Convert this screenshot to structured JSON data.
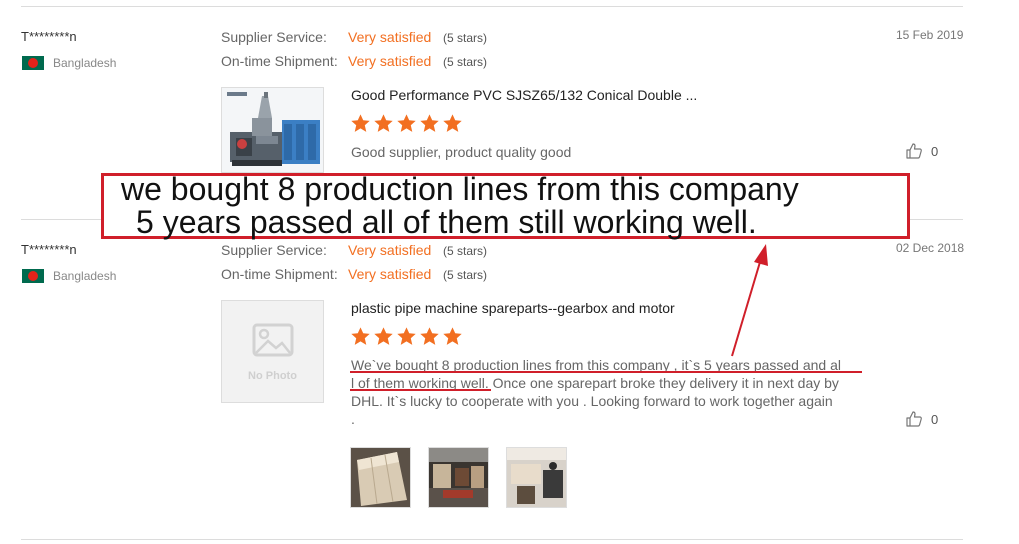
{
  "reviews": [
    {
      "user": "T********n",
      "country": "Bangladesh",
      "date": "15 Feb 2019",
      "supplier_label": "Supplier Service:",
      "supplier_value": "Very satisfied",
      "supplier_stars": "(5 stars)",
      "shipment_label": "On-time Shipment:",
      "shipment_value": "Very satisfied",
      "shipment_stars": "(5 stars)",
      "product_title": "Good Performance PVC SJSZ65/132 Conical Double ...",
      "rating": 5,
      "comment": "Good supplier, product quality good",
      "likes": "0"
    },
    {
      "user": "T********n",
      "country": "Bangladesh",
      "date": "02 Dec 2018",
      "supplier_label": "Supplier Service:",
      "supplier_value": "Very satisfied",
      "supplier_stars": "(5 stars)",
      "shipment_label": "On-time Shipment:",
      "shipment_value": "Very satisfied",
      "shipment_stars": "(5 stars)",
      "product_title": "plastic pipe machine spareparts--gearbox and motor",
      "rating": 5,
      "no_photo_text": "No Photo",
      "comment_lines": [
        "We`ve bought 8 production lines from this company , it`s 5 years passed and al",
        "l of them working well. Once one sparepart broke they delivery it in next day by",
        "DHL. It`s lucky to cooperate with you . Looking forward to work together again",
        "."
      ],
      "likes": "0"
    }
  ],
  "annotation": {
    "line1": "we bought 8 production lines from this company",
    "line2": "5 years passed all of them still working well.",
    "color": "#d01f2a"
  },
  "colors": {
    "accent": "#f26f21",
    "star": "#f26f21"
  },
  "icons": {
    "like": "thumbs-up-icon",
    "star": "star-icon",
    "flag": "bangladesh-flag-icon"
  }
}
